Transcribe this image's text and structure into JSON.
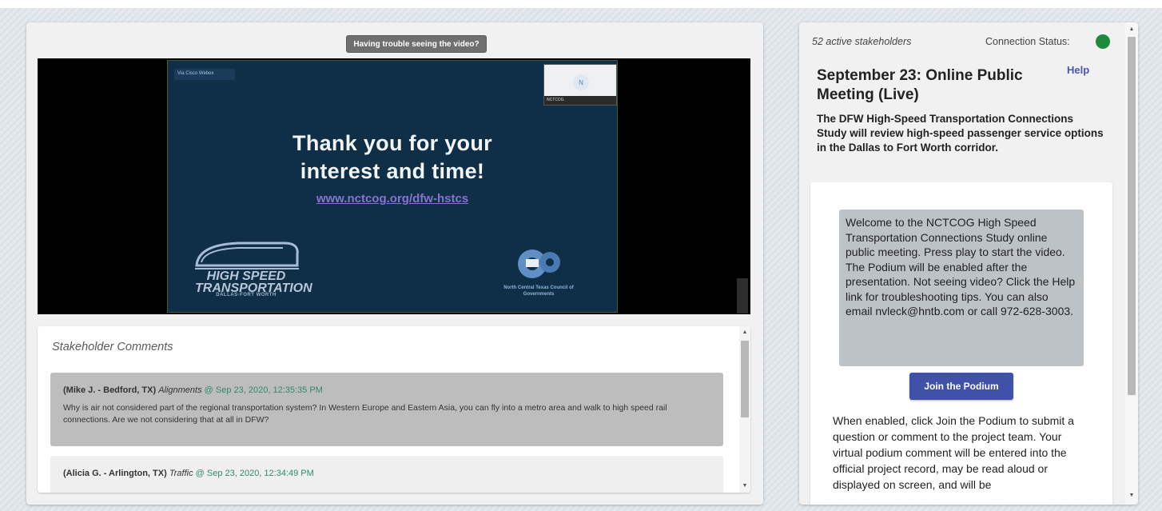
{
  "video": {
    "trouble_label": "Having trouble seeing the video?",
    "webex_label": "Via Cisco Webex",
    "participant_name": "NCTCOG",
    "participant_initial": "N",
    "slide_title_line1": "Thank you for your",
    "slide_title_line2": "interest and time!",
    "slide_link": "www.nctcog.org/dfw-hstcs",
    "logo_left_line1": "HIGH SPEED",
    "logo_left_line2": "TRANSPORTATION",
    "logo_left_sub": "DALLAS-FORT WORTH",
    "logo_right_text": "North Central Texas Council of Governments"
  },
  "comments": {
    "title": "Stakeholder Comments",
    "items": [
      {
        "author": "(Mike J. - Bedford, TX)",
        "topic": "Alignments",
        "timestamp": "@ Sep 23, 2020, 12:35:35 PM",
        "body": "Why is air not considered part of the regional transportation system? In Western Europe and Eastern Asia, you can fly into a metro area and walk to high speed rail connections. Are we not considering that at all in DFW?"
      },
      {
        "author": "(Alicia G. - Arlington, TX)",
        "topic": "Traffic",
        "timestamp": "@ Sep 23, 2020, 12:34:49 PM",
        "body": ""
      }
    ]
  },
  "sidebar": {
    "stakeholders": "52 active stakeholders",
    "connection_label": "Connection Status:",
    "connection_color": "#1e8a3c",
    "title": "September 23: Online Public Meeting (Live)",
    "help": "Help",
    "description": "The DFW High-Speed Transportation Connections Study will review high-speed passenger service options in the Dallas to Fort Worth corridor.",
    "welcome": "Welcome to the NCTCOG High Speed Transportation Connections Study online public meeting. Press play to start the video. The Podium will be enabled after the presentation. Not seeing video? Click the Help link for troubleshooting tips. You can also email nvleck@hntb.com or call 972-628-3003.",
    "join_button": "Join the Podium",
    "enabled_text": "When enabled, click Join the Podium to submit a question or comment to the project team. Your virtual podium comment will be entered into the official project record, may be read aloud or displayed on screen, and will be"
  }
}
